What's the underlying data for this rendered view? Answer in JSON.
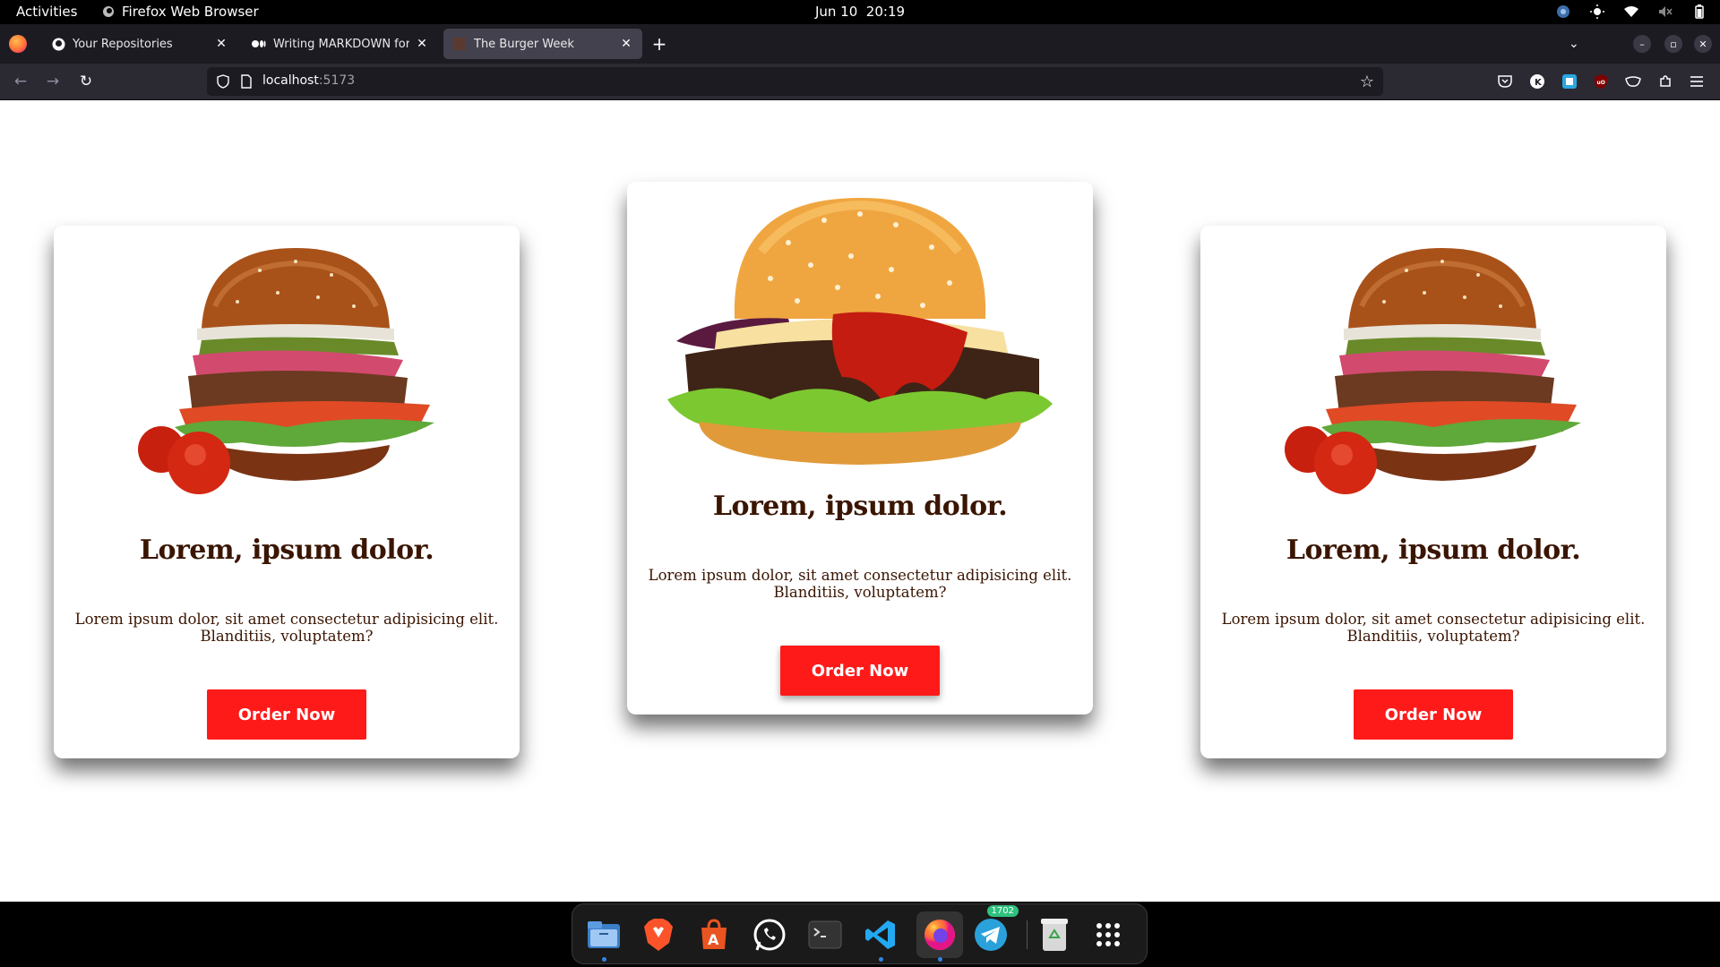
{
  "topbar": {
    "activities": "Activities",
    "app_name": "Firefox Web Browser",
    "date": "Jun 10",
    "time": "20:19"
  },
  "tabs": [
    {
      "title": "Your Repositories",
      "icon": "github-icon",
      "active": false
    },
    {
      "title": "Writing MARKDOWN for yo",
      "icon": "medium-icon",
      "active": false
    },
    {
      "title": "The Burger Week",
      "icon": "site-favicon",
      "active": true
    }
  ],
  "urlbar": {
    "host": "localhost",
    "port": ":5173"
  },
  "cards": [
    {
      "title": "Lorem, ipsum dolor.",
      "text": "Lorem ipsum dolor, sit amet consectetur adipisicing elit. Blanditiis, voluptatem?",
      "button": "Order Now",
      "image": "burger-with-tomatoes"
    },
    {
      "title": "Lorem, ipsum dolor.",
      "text": "Lorem ipsum dolor, sit amet consectetur adipisicing elit. Blanditiis, voluptatem?",
      "button": "Order Now",
      "image": "sesame-cheeseburger"
    },
    {
      "title": "Lorem, ipsum dolor.",
      "text": "Lorem ipsum dolor, sit amet consectetur adipisicing elit. Blanditiis, voluptatem?",
      "button": "Order Now",
      "image": "burger-with-tomatoes"
    }
  ],
  "dock": {
    "items": [
      "files-icon",
      "brave-icon",
      "app-center-icon",
      "whatsapp-icon",
      "terminal-icon",
      "vscode-icon",
      "firefox-icon",
      "telegram-icon",
      "trash-icon",
      "app-grid-icon"
    ],
    "telegram_badge": "1702"
  },
  "colors": {
    "accent_button": "#ff1a1a",
    "heading_text": "#3a1502",
    "browser_chrome": "#1c1b22"
  }
}
